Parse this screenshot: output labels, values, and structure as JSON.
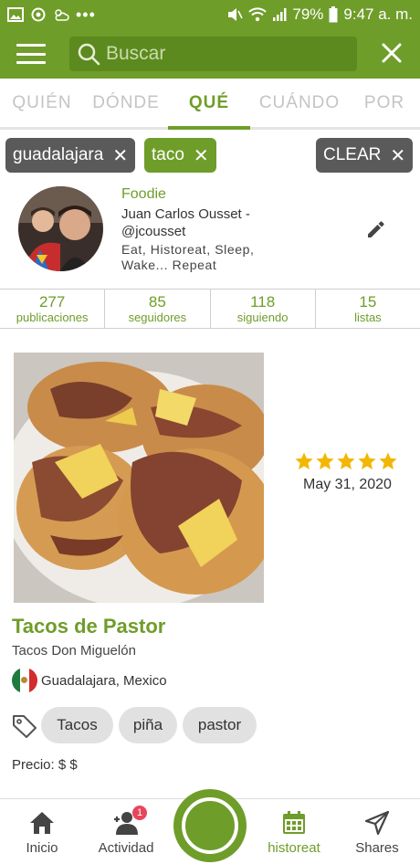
{
  "status_bar": {
    "battery": "79%",
    "time": "9:47 a. m."
  },
  "app_bar": {
    "search_placeholder": "Buscar"
  },
  "tabs": [
    {
      "label": "QUIÉN"
    },
    {
      "label": "DÓNDE"
    },
    {
      "label": "QUÉ"
    },
    {
      "label": "CUÁNDO"
    },
    {
      "label": "POR"
    }
  ],
  "filters": {
    "chips": [
      "guadalajara",
      "taco"
    ],
    "clear_label": "CLEAR"
  },
  "profile": {
    "type": "Foodie",
    "name": "Juan Carlos Ousset - @jcousset",
    "bio": "Eat, Historeat, Sleep, Wake... Repeat"
  },
  "stats": [
    {
      "value": "277",
      "label": "publicaciones"
    },
    {
      "value": "85",
      "label": "seguidores"
    },
    {
      "value": "118",
      "label": "siguiendo"
    },
    {
      "value": "15",
      "label": "listas"
    }
  ],
  "post": {
    "rating": 5,
    "date": "May 31, 2020",
    "title": "Tacos de Pastor",
    "restaurant": "Tacos Don Miguelón",
    "city": "Guadalajara, Mexico",
    "tags": [
      "Tacos",
      "piña",
      "pastor"
    ],
    "price": "Precio: $ $"
  },
  "bottom_nav": {
    "inicio": "Inicio",
    "actividad": "Actividad",
    "actividad_badge": "1",
    "historeat": "historeat",
    "shares": "Shares"
  },
  "colors": {
    "brand_green": "#6f9d2a",
    "star_gold": "#f2b705",
    "badge_red": "#e8455a"
  }
}
